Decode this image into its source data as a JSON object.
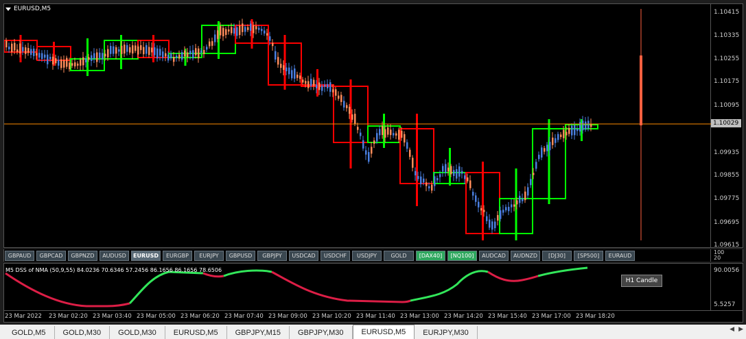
{
  "chart": {
    "title": "EURUSD,M5",
    "current_price": "1.10029",
    "price_ticks": [
      "1.10415",
      "1.10335",
      "1.10255",
      "1.10175",
      "1.10095",
      "1.09935",
      "1.09855",
      "1.09775",
      "1.09695",
      "1.09615"
    ],
    "colors": {
      "bull": "#00ff00",
      "bear": "#ff0000",
      "bull_small": "#4a7fe0",
      "bear_small": "#ff8c5a",
      "price_line": "#ff8c00"
    }
  },
  "symbols": [
    {
      "label": "GBPAUD",
      "state": "normal"
    },
    {
      "label": "GBPCAD",
      "state": "normal"
    },
    {
      "label": "GBPNZD",
      "state": "normal"
    },
    {
      "label": "AUDUSD",
      "state": "normal"
    },
    {
      "label": "EURUSD",
      "state": "active"
    },
    {
      "label": "EURGBP",
      "state": "normal"
    },
    {
      "label": "EURJPY",
      "state": "normal"
    },
    {
      "label": "GBPUSD",
      "state": "normal"
    },
    {
      "label": "GBPJPY",
      "state": "normal"
    },
    {
      "label": "USDCAD",
      "state": "normal"
    },
    {
      "label": "USDCHF",
      "state": "normal"
    },
    {
      "label": "USDJPY",
      "state": "normal"
    },
    {
      "label": "GOLD",
      "state": "normal"
    },
    {
      "label": "[DAX40]",
      "state": "green"
    },
    {
      "label": "[NQ100]",
      "state": "green"
    },
    {
      "label": "AUDCAD",
      "state": "normal"
    },
    {
      "label": "AUDNZD",
      "state": "normal"
    },
    {
      "label": "[DJ30]",
      "state": "normal"
    },
    {
      "label": "[SP500]",
      "state": "normal"
    },
    {
      "label": "EURAUD",
      "state": "normal"
    }
  ],
  "indicator": {
    "title": "M5 DSS of NMA (50,9,55) 84.0236 70.6346 57.2456 86.1656 86.1656 78.6506",
    "scale_top_1": "100",
    "scale_top_2": "20",
    "scale_max": "90.0056",
    "scale_min": "5.5257",
    "button_label": "H1 Candle"
  },
  "time_labels": [
    "23 Mar 2022",
    "23 Mar 02:20",
    "23 Mar 03:40",
    "23 Mar 05:00",
    "23 Mar 06:20",
    "23 Mar 07:40",
    "23 Mar 09:00",
    "23 Mar 10:20",
    "23 Mar 11:40",
    "23 Mar 13:00",
    "23 Mar 14:20",
    "23 Mar 15:40",
    "23 Mar 17:00",
    "23 Mar 18:20"
  ],
  "tabs": [
    {
      "label": "GOLD,M5",
      "active": false
    },
    {
      "label": "GOLD,M30",
      "active": false
    },
    {
      "label": "GOLD,M30",
      "active": false
    },
    {
      "label": "EURUSD,M5",
      "active": false
    },
    {
      "label": "GBPJPY,M15",
      "active": false
    },
    {
      "label": "GBPJPY,M30",
      "active": false
    },
    {
      "label": "EURUSD,M5",
      "active": true
    },
    {
      "label": "EURJPY,M30",
      "active": false
    }
  ],
  "tab_nav": {
    "prev": "◀",
    "next": "▶"
  }
}
